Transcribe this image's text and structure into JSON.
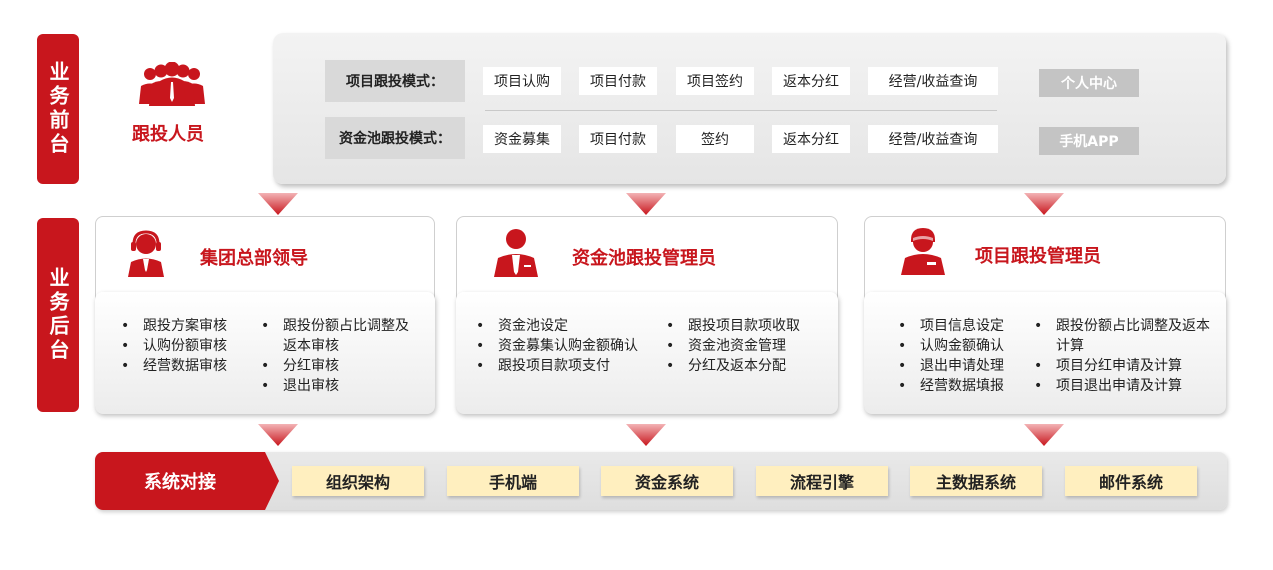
{
  "front": {
    "label": "业务前台",
    "people_title": "跟投人员",
    "modes": [
      {
        "label": "项目跟投模式：",
        "steps": [
          "项目认购",
          "项目付款",
          "项目签约",
          "返本分红",
          "经营/收益查询"
        ],
        "button": "个人中心"
      },
      {
        "label": "资金池跟投模式：",
        "steps": [
          "资金募集",
          "项目付款",
          "签约",
          "返本分红",
          "经营/收益查询"
        ],
        "button": "手机APP"
      }
    ]
  },
  "back": {
    "label": "业务后台",
    "roles": [
      {
        "title": "集团总部领导",
        "col1": [
          "跟投方案审核",
          "认购份额审核",
          "经营数据审核"
        ],
        "col2": [
          "跟投份额占比调整及返本审核",
          "分红审核",
          "退出审核"
        ]
      },
      {
        "title": "资金池跟投管理员",
        "col1": [
          "资金池设定",
          "资金募集认购金额确认",
          "跟投项目款项支付"
        ],
        "col2": [
          "跟投项目款项收取",
          "资金池资金管理",
          "分红及返本分配"
        ]
      },
      {
        "title": "项目跟投管理员",
        "col1": [
          "项目信息设定",
          "认购金额确认",
          "退出申请处理",
          "经营数据填报"
        ],
        "col2": [
          "跟投份额占比调整及返本计算",
          "项目分红申请及计算",
          "项目退出申请及计算"
        ]
      }
    ]
  },
  "system": {
    "label": "系统对接",
    "items": [
      "组织架构",
      "手机端",
      "资金系统",
      "流程引擎",
      "主数据系统",
      "邮件系统"
    ]
  },
  "colors": {
    "accent": "#c8161d",
    "system_item_bg": "#ffefbf",
    "panel_gray": "#e9e9e9"
  },
  "icons": [
    "group-people-icon",
    "arrow-down-icon",
    "headset-person-icon",
    "businessman-icon",
    "staff-person-icon"
  ]
}
